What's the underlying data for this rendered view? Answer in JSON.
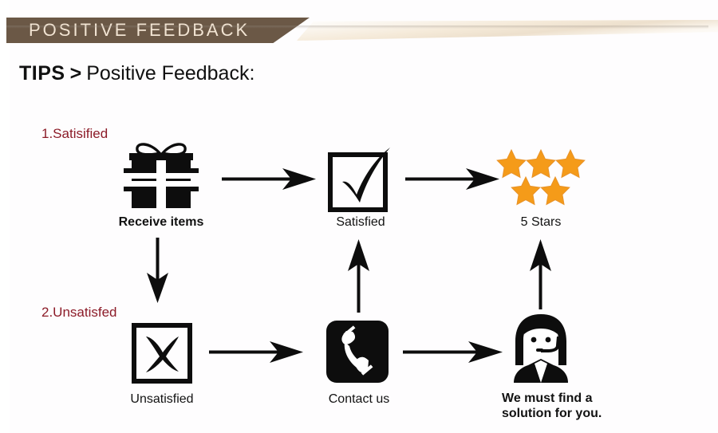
{
  "banner": {
    "title": "POSITIVE  FEEDBACK",
    "bar_color": "#6b5846",
    "text_color": "#f2e4d3",
    "tail_color": "#efe0cc"
  },
  "heading": {
    "bold_part": "TIPS",
    "separator": ">",
    "rest": "Positive Feedback:",
    "color": "#111111"
  },
  "steps": [
    {
      "label": "1.Satisified",
      "color": "#8c1b28"
    },
    {
      "label": "2.Unsatisfed",
      "color": "#8c1b28"
    }
  ],
  "nodes": {
    "receive_items": {
      "label": "Receive items",
      "icon": "gift-box-icon"
    },
    "satisfied": {
      "label": "Satisfied",
      "icon": "checkbox-check-icon"
    },
    "five_stars": {
      "label": "5 Stars",
      "icon": "five-stars-icon",
      "star_count": 5,
      "star_color": "#f59b19"
    },
    "unsatisfied": {
      "label": "Unsatisfied",
      "icon": "checkbox-cross-icon"
    },
    "contact_us": {
      "label": "Contact us",
      "icon": "telephone-icon"
    },
    "solution": {
      "label": "We must find a solution for you.",
      "icon": "support-agent-icon"
    }
  },
  "arrows": [
    {
      "name": "arrow-receive-to-satisfied",
      "direction": "right"
    },
    {
      "name": "arrow-satisfied-to-stars",
      "direction": "right"
    },
    {
      "name": "arrow-receive-to-unsatisfied",
      "direction": "down"
    },
    {
      "name": "arrow-unsatisfied-to-contact",
      "direction": "right"
    },
    {
      "name": "arrow-contact-to-agent",
      "direction": "right"
    },
    {
      "name": "arrow-contact-to-satisfied",
      "direction": "up"
    },
    {
      "name": "arrow-agent-to-stars",
      "direction": "up"
    }
  ],
  "chart_data": {
    "type": "diagram",
    "title": "Positive Feedback flow",
    "nodes": [
      "Receive items",
      "Satisfied",
      "5 Stars",
      "Unsatisfied",
      "Contact us",
      "We must find a solution for you."
    ],
    "edges": [
      [
        "Receive items",
        "Satisfied"
      ],
      [
        "Satisfied",
        "5 Stars"
      ],
      [
        "Receive items",
        "Unsatisfied"
      ],
      [
        "Unsatisfied",
        "Contact us"
      ],
      [
        "Contact us",
        "We must find a solution for you."
      ],
      [
        "Contact us",
        "Satisfied"
      ],
      [
        "We must find a solution for you.",
        "5 Stars"
      ]
    ]
  }
}
